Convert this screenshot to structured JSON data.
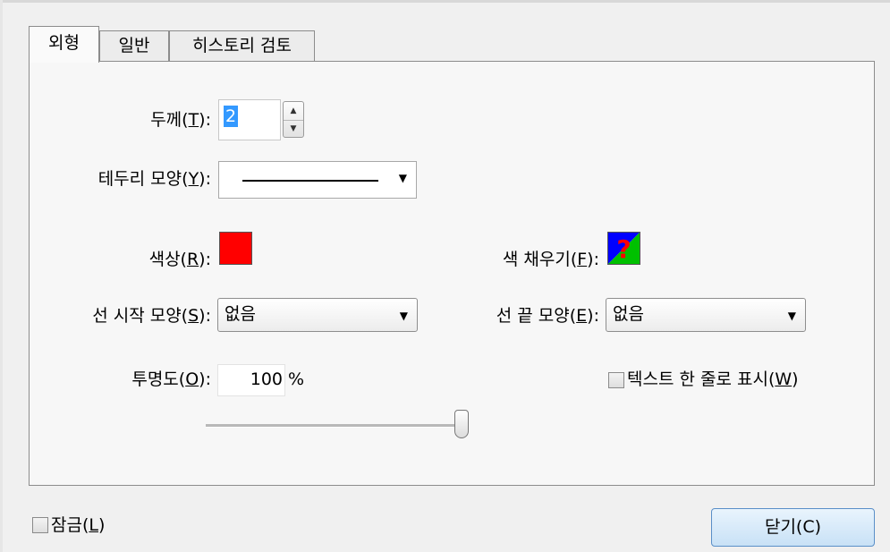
{
  "tabs": [
    {
      "label": "외형",
      "active": true
    },
    {
      "label": "일반",
      "active": false
    },
    {
      "label": "히스토리 검토",
      "active": false
    }
  ],
  "thickness": {
    "label_pre": "두께(",
    "mnemonic": "T",
    "label_post": "):",
    "value": "2"
  },
  "border_style": {
    "label_pre": "테두리 모양(",
    "mnemonic": "Y",
    "label_post": "):"
  },
  "color": {
    "label_pre": "색상(",
    "mnemonic": "R",
    "label_post": "):",
    "value": "#ff0000"
  },
  "fill_color": {
    "label_pre": "색 채우기(",
    "mnemonic": "F",
    "label_post": "):",
    "glyph": "?",
    "note": "no-fill swatch"
  },
  "line_start": {
    "label_pre": "선 시작 모양(",
    "mnemonic": "S",
    "label_post": "):",
    "value": "없음"
  },
  "line_end": {
    "label_pre": "선 끝 모양(",
    "mnemonic": "E",
    "label_post": "):",
    "value": "없음"
  },
  "opacity": {
    "label_pre": "투명도(",
    "mnemonic": "O",
    "label_post": "):",
    "value": "100",
    "unit": "%",
    "slider_fraction": 1.0
  },
  "show_text_one_line": {
    "label_pre": "텍스트 한 줄로 표시(",
    "mnemonic": "W",
    "label_post": ")",
    "checked": false
  },
  "lock": {
    "label_pre": "잠금(",
    "mnemonic": "L",
    "label_post": ")",
    "checked": false
  },
  "close_button": {
    "label": "닫기(C)"
  },
  "colors": {
    "accent_blue": "#3399ff",
    "fill_swatch_blue": "#0000ff",
    "fill_swatch_green": "#00c000"
  }
}
